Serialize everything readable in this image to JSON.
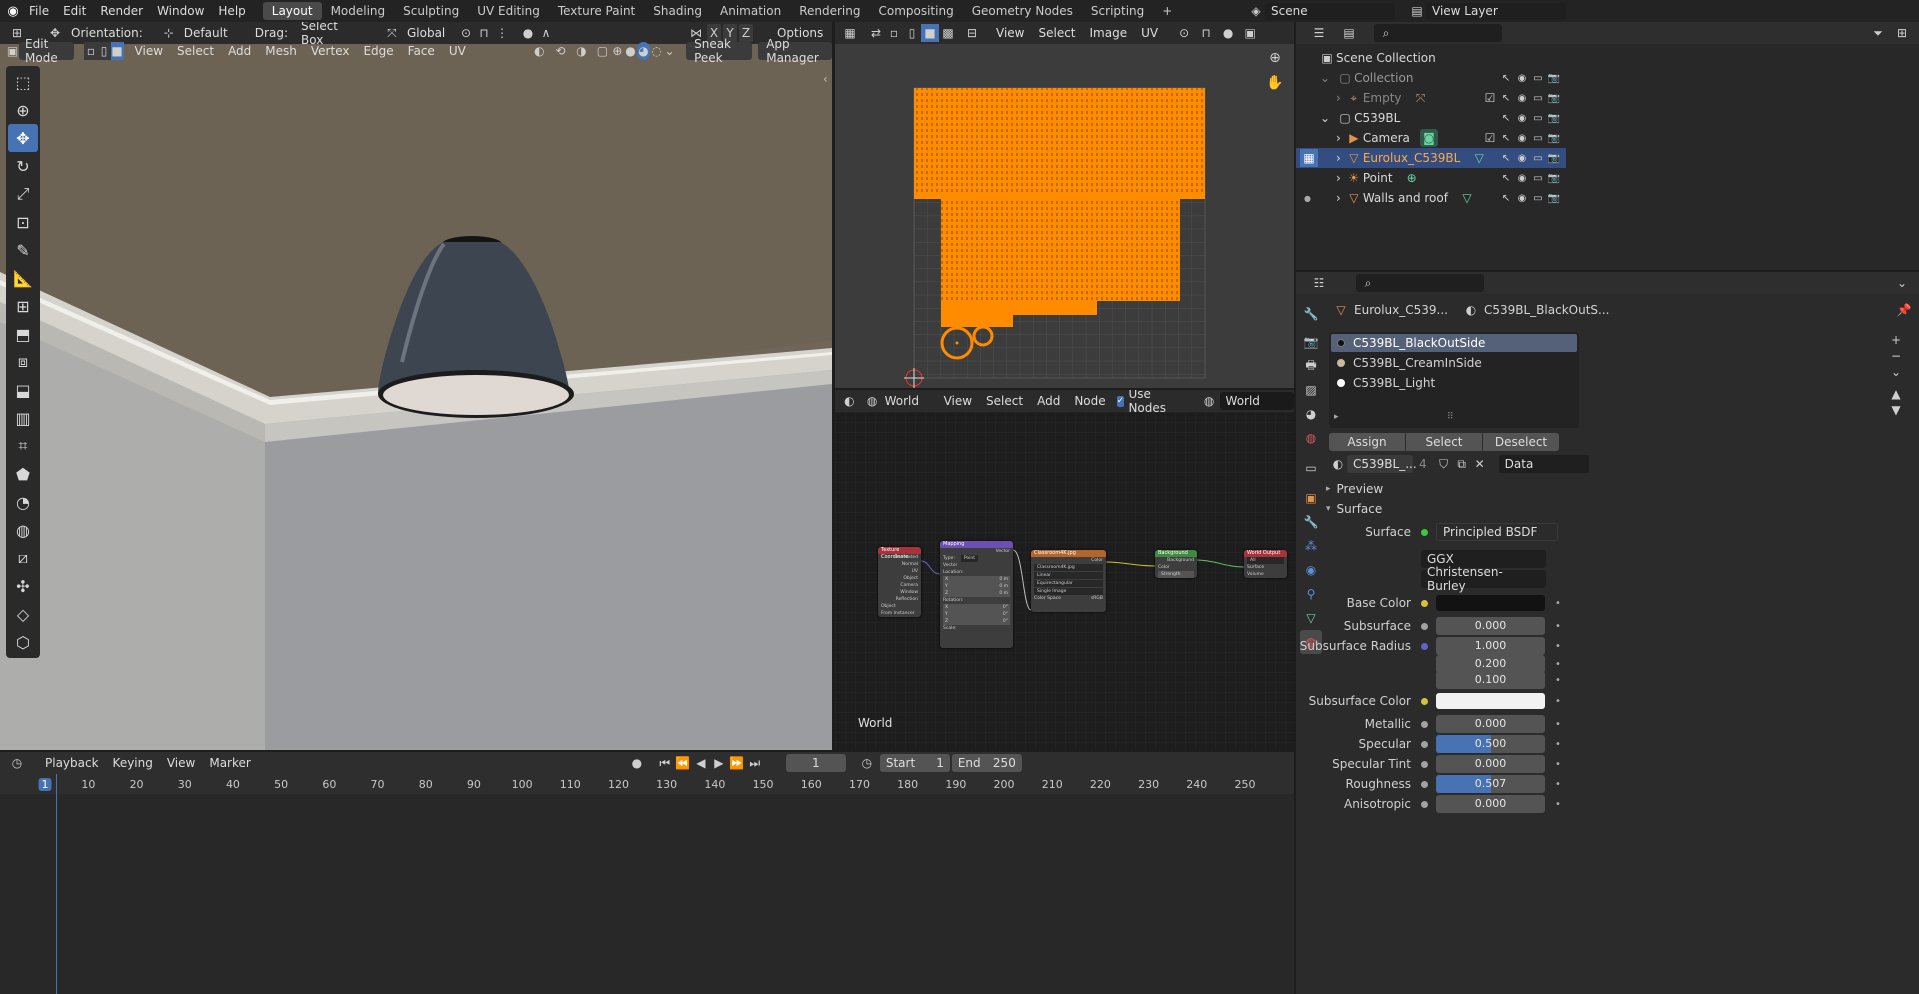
{
  "topbar": {
    "menus": [
      "File",
      "Edit",
      "Render",
      "Window",
      "Help"
    ],
    "workspaces": [
      "Layout",
      "Modeling",
      "Sculpting",
      "UV Editing",
      "Texture Paint",
      "Shading",
      "Animation",
      "Rendering",
      "Compositing",
      "Geometry Nodes",
      "Scripting"
    ],
    "active_workspace": "Layout",
    "add_tab": "+",
    "scene": "Scene",
    "view_layer": "View Layer"
  },
  "viewport": {
    "orientation_label": "Orientation:",
    "orientation_value": "Default",
    "drag_label": "Drag:",
    "drag_value": "Select Box",
    "transform_space": "Global",
    "axes": [
      "X",
      "Y",
      "Z"
    ],
    "options": "Options",
    "mode": "Edit Mode",
    "menus": [
      "View",
      "Select",
      "Add",
      "Mesh",
      "Vertex",
      "Edge",
      "Face",
      "UV"
    ],
    "sneak_peek": "Sneak Peek",
    "app_manager": "App Manager"
  },
  "uv_editor": {
    "menus": [
      "View",
      "Select",
      "Image",
      "UV"
    ]
  },
  "node_editor": {
    "type": "World",
    "menus": [
      "View",
      "Select",
      "Add",
      "Node"
    ],
    "use_nodes": "Use Nodes",
    "world_name": "World",
    "footer_label": "World",
    "nodes": {
      "tex_coord": {
        "title": "Texture Coordinate",
        "outputs": [
          "Generated",
          "Normal",
          "UV",
          "Object",
          "Camera",
          "Window",
          "Reflection"
        ],
        "object": "Object",
        "instancer": "From Instancer"
      },
      "mapping": {
        "title": "Mapping",
        "out": "Vector",
        "type_label": "Type:",
        "type": "Point",
        "vector": "Vector",
        "location": "Location:",
        "rotation": "Rotation:",
        "scale": "Scale:",
        "loc": [
          "0 m",
          "0 m",
          "0 m"
        ],
        "rot": [
          "0°",
          "0°",
          "0°"
        ],
        "scl": [
          "1.000",
          "1.000",
          "1.000"
        ],
        "xyz": [
          "X",
          "Y",
          "Z"
        ]
      },
      "env": {
        "title": "Classroom4K.jpg",
        "color": "Color",
        "file": "Classroom4K.jpg",
        "interp": "Linear",
        "proj": "Equirectangular",
        "src": "Single Image",
        "cs_label": "Color Space",
        "cs": "sRGB",
        "vector": "Vector"
      },
      "bg": {
        "title": "Background",
        "out": "Background",
        "color": "Color",
        "strength": "Strength 2.000"
      },
      "out": {
        "title": "World Output",
        "target": "All",
        "surface": "Surface",
        "volume": "Volume"
      }
    }
  },
  "outliner": {
    "root": "Scene Collection",
    "items": [
      {
        "name": "Collection",
        "level": 0
      },
      {
        "name": "Empty",
        "level": 1
      },
      {
        "name": "C539BL",
        "level": 0
      },
      {
        "name": "Camera",
        "level": 1
      },
      {
        "name": "Eurolux_C539BL",
        "level": 1
      },
      {
        "name": "Point",
        "level": 1
      },
      {
        "name": "Walls and roof",
        "level": 1
      }
    ]
  },
  "properties": {
    "object_name": "Eurolux_C539...",
    "material_name": "C539BL_BlackOutS...",
    "slots": [
      "C539BL_BlackOutSide",
      "C539BL_CreamInSide",
      "C539BL_Light"
    ],
    "assign": "Assign",
    "select": "Select",
    "deselect": "Deselect",
    "mat_field": "C539BL_...",
    "users": "4",
    "link": "Data",
    "panels": {
      "preview": "Preview",
      "surface": "Surface"
    },
    "surface_label": "Surface",
    "surface_value": "Principled BSDF",
    "distribution": "GGX",
    "subsurface_method": "Christensen-Burley",
    "fields": [
      {
        "label": "Base Color",
        "value": "",
        "kind": "color",
        "color": "#121212",
        "dot": "#d6c23a"
      },
      {
        "label": "Subsurface",
        "value": "0.000",
        "kind": "num",
        "fill": 0,
        "dot": "#a1a1a1"
      },
      {
        "label": "Subsurface Radius",
        "value": "1.000",
        "kind": "num",
        "fill": 0,
        "dot": "#6363c7"
      },
      {
        "label": "",
        "value": "0.200",
        "kind": "num",
        "fill": 0,
        "dot": ""
      },
      {
        "label": "",
        "value": "0.100",
        "kind": "num",
        "fill": 0,
        "dot": ""
      },
      {
        "label": "Subsurface Color",
        "value": "",
        "kind": "color",
        "color": "#f2f2f2",
        "dot": "#d6c23a"
      },
      {
        "label": "Metallic",
        "value": "0.000",
        "kind": "num",
        "fill": 0,
        "dot": "#a1a1a1"
      },
      {
        "label": "Specular",
        "value": "0.500",
        "kind": "num",
        "fill": 0.5,
        "dot": "#a1a1a1"
      },
      {
        "label": "Specular Tint",
        "value": "0.000",
        "kind": "num",
        "fill": 0,
        "dot": "#a1a1a1"
      },
      {
        "label": "Roughness",
        "value": "0.507",
        "kind": "num",
        "fill": 0.507,
        "dot": "#a1a1a1"
      },
      {
        "label": "Anisotropic",
        "value": "0.000",
        "kind": "num",
        "fill": 0,
        "dot": "#a1a1a1"
      }
    ]
  },
  "timeline": {
    "menus": [
      "Playback",
      "Keying",
      "View",
      "Marker"
    ],
    "current_frame": "1",
    "start_label": "Start",
    "start": "1",
    "end_label": "End",
    "end": "250",
    "ticks": [
      "1",
      "10",
      "20",
      "30",
      "40",
      "50",
      "60",
      "70",
      "80",
      "90",
      "100",
      "110",
      "120",
      "130",
      "140",
      "150",
      "160",
      "170",
      "180",
      "190",
      "200",
      "210",
      "220",
      "230",
      "240",
      "250"
    ]
  },
  "colors": {
    "accent": "#4772b3",
    "selected_orange": "#ff8c00",
    "header": "#303030"
  }
}
